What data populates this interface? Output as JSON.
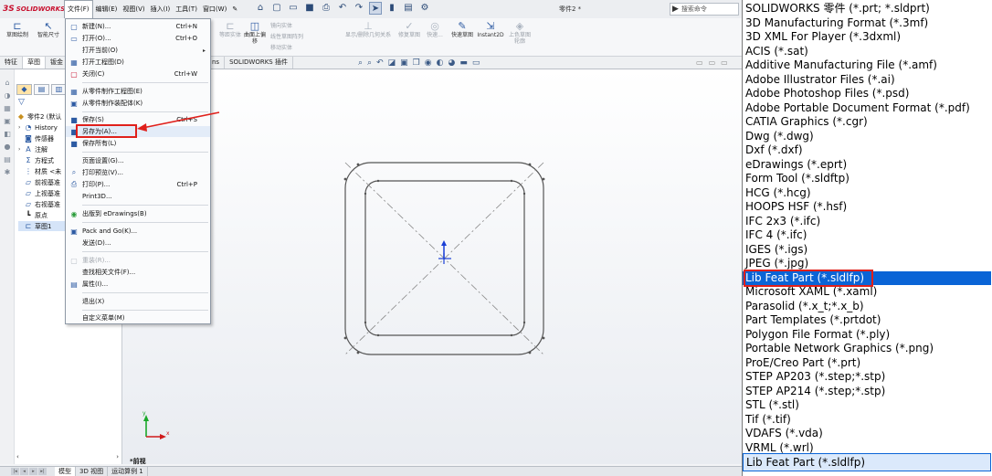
{
  "app": {
    "logo": "SOLIDWORKS",
    "logo_mark": "3S",
    "doc_title": "零件2 *",
    "search_placeholder": "搜索命令"
  },
  "menubar": {
    "items": [
      "文件(F)",
      "编辑(E)",
      "视图(V)",
      "插入(I)",
      "工具(T)",
      "窗口(W)"
    ]
  },
  "ribbon": {
    "sketch": "草图绘制",
    "smart_dim": "智能尺寸",
    "equal": "等距实体",
    "surface_offset": "曲面上偏移",
    "mirror": "镜向实体",
    "linear_array": "线性草图阵列",
    "move": "移动实体",
    "show_hide": "显示/删除几何关系",
    "repair": "修复草图",
    "quick": "快速...",
    "quick_sketch": "快速草图",
    "instant2d": "Instant2D",
    "shaded": "上色草图轮廓"
  },
  "feature_tabs": [
    "特征",
    "草图",
    "钣金"
  ],
  "feature_tabs_extra": [
    "ns",
    "SOLIDWORKS 插件"
  ],
  "tree": {
    "root": "零件2 (默认",
    "items": [
      "History",
      "传感器",
      "注解",
      "方程式",
      "材质 <未",
      "前视基准",
      "上视基准",
      "右视基准",
      "原点",
      "草图1"
    ]
  },
  "file_menu": {
    "items": [
      {
        "label": "新建(N)...",
        "shortcut": "Ctrl+N"
      },
      {
        "label": "打开(O)...",
        "shortcut": "Ctrl+O"
      },
      {
        "label": "打开当前(O)",
        "shortcut": ""
      },
      {
        "label": "打开工程图(D)",
        "shortcut": ""
      },
      {
        "label": "关闭(C)",
        "shortcut": "Ctrl+W"
      },
      {
        "label": "从零件制作工程图(E)",
        "shortcut": ""
      },
      {
        "label": "从零件制作装配体(K)",
        "shortcut": ""
      },
      {
        "label": "保存(S)",
        "shortcut": "Ctrl+S"
      },
      {
        "label": "另存为(A)...",
        "shortcut": ""
      },
      {
        "label": "保存所有(L)",
        "shortcut": ""
      },
      {
        "label": "页面设置(G)...",
        "shortcut": ""
      },
      {
        "label": "打印预览(V)...",
        "shortcut": ""
      },
      {
        "label": "打印(P)...",
        "shortcut": "Ctrl+P"
      },
      {
        "label": "Print3D...",
        "shortcut": ""
      },
      {
        "label": "出版到 eDrawings(B)",
        "shortcut": ""
      },
      {
        "label": "Pack and Go(K)...",
        "shortcut": ""
      },
      {
        "label": "发送(D)...",
        "shortcut": ""
      },
      {
        "label": "重装(R)...",
        "shortcut": ""
      },
      {
        "label": "查找相关文件(F)...",
        "shortcut": ""
      },
      {
        "label": "属性(I)...",
        "shortcut": ""
      },
      {
        "label": "退出(X)",
        "shortcut": ""
      },
      {
        "label": "自定义菜单(M)",
        "shortcut": ""
      }
    ]
  },
  "view_label": "*前视",
  "bottom_tabs": [
    "模型",
    "3D 视图",
    "运动算例 1"
  ],
  "file_types": [
    "SOLIDWORKS 零件 (*.prt; *.sldprt)",
    "3D Manufacturing Format (*.3mf)",
    "3D XML For Player (*.3dxml)",
    "ACIS (*.sat)",
    "Additive Manufacturing File (*.amf)",
    "Adobe Illustrator Files (*.ai)",
    "Adobe Photoshop Files (*.psd)",
    "Adobe Portable Document Format (*.pdf)",
    "CATIA Graphics (*.cgr)",
    "Dwg (*.dwg)",
    "Dxf (*.dxf)",
    "eDrawings (*.eprt)",
    "Form Tool (*.sldftp)",
    "HCG (*.hcg)",
    "HOOPS HSF (*.hsf)",
    "IFC 2x3 (*.ifc)",
    "IFC 4 (*.ifc)",
    "IGES (*.igs)",
    "JPEG (*.jpg)",
    "Lib Feat Part (*.sldlfp)",
    "Microsoft XAML (*.xaml)",
    "Parasolid (*.x_t;*.x_b)",
    "Part Templates (*.prtdot)",
    "Polygon File Format (*.ply)",
    "Portable Network Graphics (*.png)",
    "ProE/Creo Part (*.prt)",
    "STEP AP203 (*.step;*.stp)",
    "STEP AP214 (*.step;*.stp)",
    "STL (*.stl)",
    "Tif (*.tif)",
    "VDAFS (*.vda)",
    "VRML (*.wrl)"
  ],
  "selected_file_type": "Lib Feat Part (*.sldlfp)",
  "colors": {
    "selection": "#0a64d6",
    "annotation_red": "#e0201b",
    "brand": "#c8102e"
  }
}
